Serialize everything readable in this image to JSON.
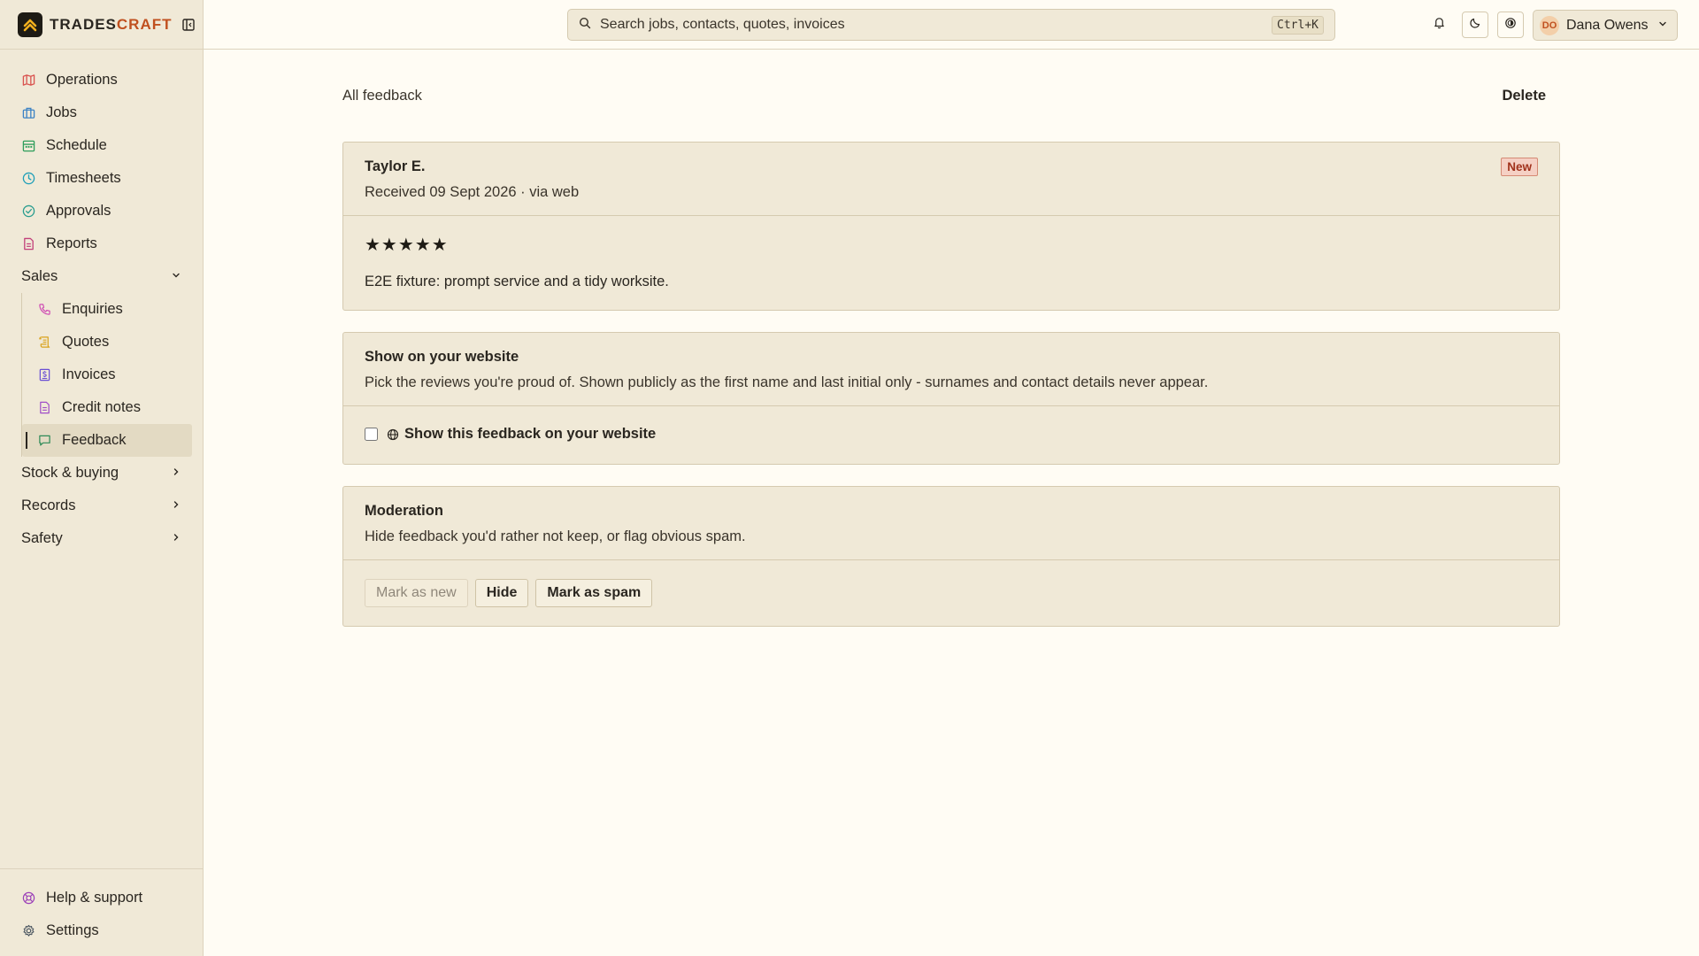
{
  "brand": {
    "name_part1": "TRADES",
    "name_part2": "CRAFT"
  },
  "sidebar": {
    "items": [
      {
        "label": "Operations",
        "icon": "map-icon",
        "color": "#d9534f"
      },
      {
        "label": "Jobs",
        "icon": "briefcase-icon",
        "color": "#3b82c4"
      },
      {
        "label": "Schedule",
        "icon": "calendar-icon",
        "color": "#2e9e5b"
      },
      {
        "label": "Timesheets",
        "icon": "clock-icon",
        "color": "#1f9fb8"
      },
      {
        "label": "Approvals",
        "icon": "check-circle-icon",
        "color": "#2a9d8f"
      },
      {
        "label": "Reports",
        "icon": "report-icon",
        "color": "#c2417a"
      }
    ],
    "sales_group": {
      "label": "Sales",
      "items": [
        {
          "label": "Enquiries",
          "icon": "phone-icon",
          "color": "#d04fb4"
        },
        {
          "label": "Quotes",
          "icon": "scroll-icon",
          "color": "#d9a21b"
        },
        {
          "label": "Invoices",
          "icon": "invoice-icon",
          "color": "#6a4fd4"
        },
        {
          "label": "Credit notes",
          "icon": "file-icon",
          "color": "#a04cc8"
        },
        {
          "label": "Feedback",
          "icon": "message-icon",
          "color": "#2e8b57"
        }
      ]
    },
    "groups": [
      {
        "label": "Stock & buying"
      },
      {
        "label": "Records"
      },
      {
        "label": "Safety"
      }
    ],
    "bottom": [
      {
        "label": "Help & support",
        "icon": "lifebuoy-icon",
        "color": "#9b3fb8"
      },
      {
        "label": "Settings",
        "icon": "gear-icon",
        "color": "#4a5560"
      }
    ]
  },
  "topbar": {
    "search_placeholder": "Search jobs, contacts, quotes, invoices",
    "shortcut": "Ctrl+K",
    "user_initials": "DO",
    "user_name": "Dana Owens"
  },
  "page": {
    "breadcrumb": "All feedback",
    "delete_label": "Delete"
  },
  "feedback": {
    "author": "Taylor E.",
    "received": "Received 09 Sept 2026 · via web",
    "status": "New",
    "rating": 5,
    "stars": "★★★★★",
    "comment": "E2E fixture: prompt service and a tidy worksite."
  },
  "website": {
    "title": "Show on your website",
    "description": "Pick the reviews you're proud of. Shown publicly as the first name and last initial only - surnames and contact details never appear.",
    "checkbox_label": "Show this feedback on your website",
    "checked": false
  },
  "moderation": {
    "title": "Moderation",
    "description": "Hide feedback you'd rather not keep, or flag obvious spam.",
    "buttons": {
      "mark_new": "Mark as new",
      "hide": "Hide",
      "spam": "Mark as spam"
    }
  }
}
